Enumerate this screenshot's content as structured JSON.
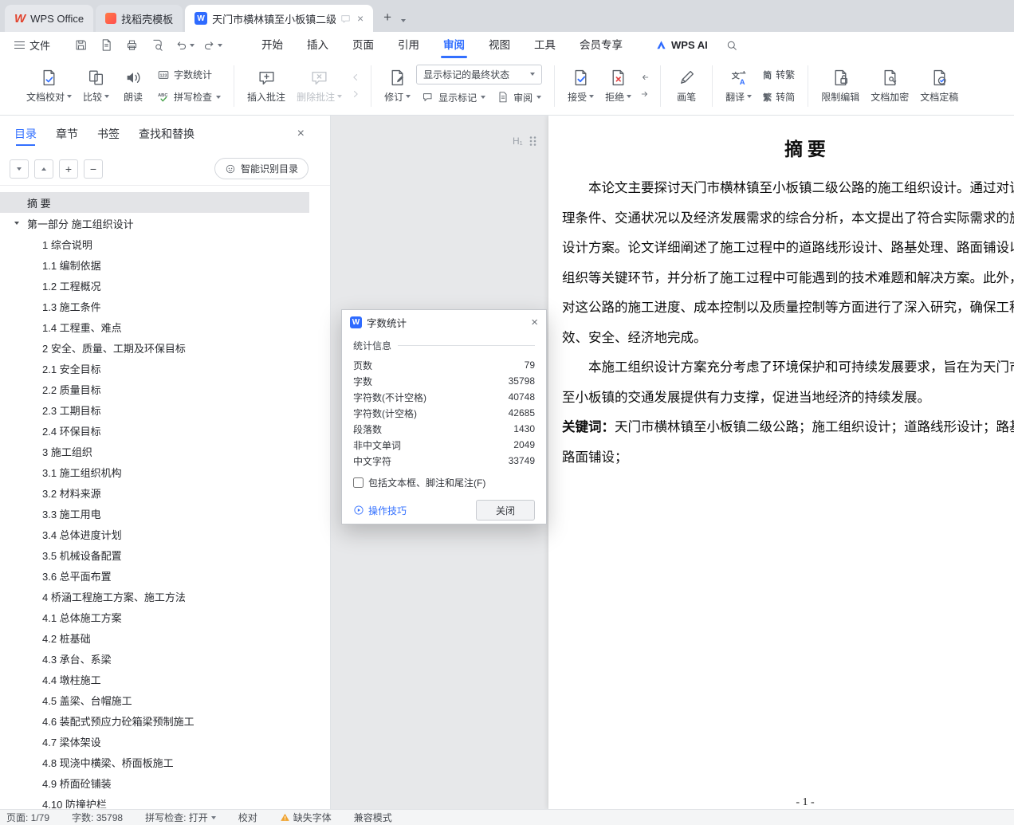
{
  "colors": {
    "accent": "#3370ff",
    "wps_red": "#e2432e",
    "warning": "#f0a32f",
    "writer_blue": "#2f6bff"
  },
  "icons": {
    "close": "×",
    "caret_down": "triangle-down",
    "caret_up": "triangle-up",
    "search": "magnifier",
    "warning": "orange-triangle-exclamation",
    "hamburger": "three-lines",
    "drag_handle": "six-dots"
  },
  "titlebar": {
    "home_tab": "WPS Office",
    "docer_tab": "找稻壳模板",
    "doc_tab": "天门市横林镇至小板镇二级公"
  },
  "menubar": {
    "file": "文件",
    "tabs": [
      {
        "label": "开始"
      },
      {
        "label": "插入"
      },
      {
        "label": "页面"
      },
      {
        "label": "引用"
      },
      {
        "label": "审阅",
        "cls": "active"
      },
      {
        "label": "视图"
      },
      {
        "label": "工具"
      },
      {
        "label": "会员专享"
      }
    ],
    "wps_ai": "WPS AI"
  },
  "ribbon": {
    "doc_proof": "文档校对",
    "compare": "比较",
    "read_aloud": "朗读",
    "word_count": "字数统计",
    "spell_check": "拼写检查",
    "insert_comment": "插入批注",
    "delete_comment": "删除批注",
    "track_changes": "修订",
    "markup_state": "显示标记的最终状态",
    "show_markup": "显示标记",
    "review": "审阅",
    "accept": "接受",
    "reject": "拒绝",
    "brush": "画笔",
    "translate": "翻译",
    "to_traditional": "转繁",
    "to_simplified": "转简",
    "restrict_edit": "限制编辑",
    "encrypt": "文档加密",
    "finalize": "文档定稿"
  },
  "sidebar": {
    "tabs": [
      {
        "label": "目录",
        "cls": "active"
      },
      {
        "label": "章节"
      },
      {
        "label": "书签"
      },
      {
        "label": "查找和替换"
      }
    ],
    "smart_toc": "智能识别目录",
    "toc": [
      {
        "label": "摘  要",
        "cls": "lvl0 selected"
      },
      {
        "label": "第一部分 施工组织设计",
        "cls": "lvl0 has-caret"
      },
      {
        "label": "1 综合说明",
        "cls": "lvl1"
      },
      {
        "label": "1.1 编制依据",
        "cls": "lvl1"
      },
      {
        "label": "1.2 工程概况",
        "cls": "lvl1"
      },
      {
        "label": "1.3 施工条件",
        "cls": "lvl1"
      },
      {
        "label": "1.4 工程重、难点",
        "cls": "lvl1"
      },
      {
        "label": "2 安全、质量、工期及环保目标",
        "cls": "lvl1"
      },
      {
        "label": "2.1 安全目标",
        "cls": "lvl1"
      },
      {
        "label": "2.2 质量目标",
        "cls": "lvl1"
      },
      {
        "label": "2.3 工期目标",
        "cls": "lvl1"
      },
      {
        "label": "2.4 环保目标",
        "cls": "lvl1"
      },
      {
        "label": "3 施工组织",
        "cls": "lvl1"
      },
      {
        "label": "3.1 施工组织机构",
        "cls": "lvl1"
      },
      {
        "label": "3.2 材料来源",
        "cls": "lvl1"
      },
      {
        "label": "3.3 施工用电",
        "cls": "lvl1"
      },
      {
        "label": "3.4 总体进度计划",
        "cls": "lvl1"
      },
      {
        "label": "3.5 机械设备配置",
        "cls": "lvl1"
      },
      {
        "label": "3.6 总平面布置",
        "cls": "lvl1"
      },
      {
        "label": "4 桥涵工程施工方案、施工方法",
        "cls": "lvl1"
      },
      {
        "label": "4.1 总体施工方案",
        "cls": "lvl1"
      },
      {
        "label": "4.2 桩基础",
        "cls": "lvl1"
      },
      {
        "label": "4.3 承台、系梁",
        "cls": "lvl1"
      },
      {
        "label": "4.4 墩柱施工",
        "cls": "lvl1"
      },
      {
        "label": "4.5 盖梁、台帽施工",
        "cls": "lvl1"
      },
      {
        "label": "4.6 装配式预应力砼箱梁预制施工",
        "cls": "lvl1"
      },
      {
        "label": "4.7 梁体架设",
        "cls": "lvl1"
      },
      {
        "label": "4.8 现浇中横梁、桥面板施工",
        "cls": "lvl1"
      },
      {
        "label": "4.9 桥面砼铺装",
        "cls": "lvl1"
      },
      {
        "label": "4.10 防撞护栏",
        "cls": "lvl1"
      }
    ]
  },
  "document": {
    "handle": "H₁",
    "title": "摘  要",
    "lines": [
      {
        "text": "本论文主要探讨天门市横林镇至小板镇二级公路的施工组织设计。通过对该区",
        "cls": "indent"
      },
      {
        "text": "理条件、交通状况以及经济发展需求的综合分析，本文提出了符合实际需求的施工"
      },
      {
        "text": "设计方案。论文详细阐述了施工过程中的道路线形设计、路基处理、路面铺设以及"
      },
      {
        "text": "组织等关键环节，并分析了施工过程中可能遇到的技术难题和解决方案。此外，本"
      },
      {
        "text": "对这公路的施工进度、成本控制以及质量控制等方面进行了深入研究，确保工程能"
      },
      {
        "text": "效、安全、经济地完成。"
      },
      {
        "text": "本施工组织设计方案充分考虑了环境保护和可持续发展要求，旨在为天门市横",
        "cls": "indent"
      },
      {
        "text": "至小板镇的交通发展提供有力支撑，促进当地经济的持续发展。"
      }
    ],
    "keywords_label": "关键词：",
    "keywords_text": "天门市横林镇至小板镇二级公路；施工组织设计；道路线形设计；路基处",
    "keywords_line2": "路面铺设；",
    "page_number": "- 1 -"
  },
  "dialog": {
    "title": "字数统计",
    "section": "统计信息",
    "stats": [
      {
        "label": "页数",
        "value": "79"
      },
      {
        "label": "字数",
        "value": "35798"
      },
      {
        "label": "字符数(不计空格)",
        "value": "40748"
      },
      {
        "label": "字符数(计空格)",
        "value": "42685"
      },
      {
        "label": "段落数",
        "value": "1430"
      },
      {
        "label": "非中文单词",
        "value": "2049"
      },
      {
        "label": "中文字符",
        "value": "33749"
      }
    ],
    "include_checkbox": "包括文本框、脚注和尾注(F)",
    "tips": "操作技巧",
    "close_button": "关闭"
  },
  "statusbar": {
    "page": "页面: 1/79",
    "words": "字数: 35798",
    "spell": "拼写检查: 打开",
    "proof": "校对",
    "missing_font": "缺失字体",
    "compat": "兼容模式"
  }
}
